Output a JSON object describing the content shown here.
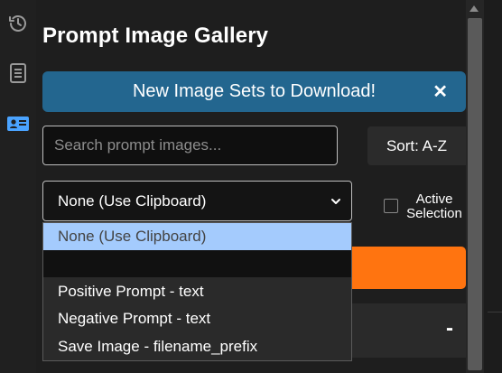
{
  "rail": {
    "icons": [
      "history-icon",
      "notes-icon",
      "id-card-icon"
    ]
  },
  "title": "Prompt Image Gallery",
  "banner": {
    "text": "New Image Sets to Download!",
    "close": "✕"
  },
  "search": {
    "placeholder": "Search prompt images...",
    "value": ""
  },
  "sort": {
    "label": "Sort: A-Z"
  },
  "target_select": {
    "selected": "None (Use Clipboard)",
    "options": [
      "None (Use Clipboard)",
      "",
      "Positive Prompt - text",
      "Negative Prompt - text",
      "Save Image - filename_prefix"
    ]
  },
  "active_selection": {
    "label_line1": "Active",
    "label_line2": "Selection",
    "checked": false
  },
  "collapse": {
    "symbol": "-"
  },
  "colors": {
    "banner": "#23668f",
    "accent_orange": "#ff7410",
    "selected_option": "#a4cbfd",
    "rail_active_icon": "#4aa3ff"
  }
}
